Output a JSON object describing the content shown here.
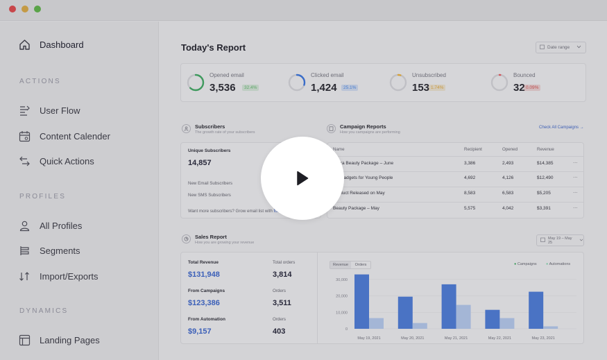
{
  "window": {
    "controls": [
      "close",
      "minimize",
      "maximize"
    ]
  },
  "sidebar": {
    "items": [
      {
        "label": "Dashboard",
        "icon": "home-icon"
      },
      {
        "label": "User Flow",
        "icon": "user-flow-icon"
      },
      {
        "label": "Content Calender",
        "icon": "calendar-icon"
      },
      {
        "label": "Quick Actions",
        "icon": "quick-actions-icon"
      },
      {
        "label": "All Profiles",
        "icon": "user-icon"
      },
      {
        "label": "Segments",
        "icon": "segments-icon"
      },
      {
        "label": "Import/Exports",
        "icon": "import-export-icon"
      },
      {
        "label": "Landing Pages",
        "icon": "layout-icon"
      }
    ],
    "sections": [
      "ACTIONS",
      "PROFILES",
      "DYNAMICS"
    ]
  },
  "main": {
    "title": "Today's Report",
    "date_range": "Date range",
    "stats": [
      {
        "label": "Opened email",
        "value": "3,536",
        "badge": "32.4%",
        "badge_color": "#5fa86a",
        "ring_color": "#3f9a5e",
        "fill": 0.62
      },
      {
        "label": "Clicked email",
        "value": "1,424",
        "badge": "25.1%",
        "badge_color": "#4a7fd0",
        "ring_color": "#3a6dc9",
        "fill": 0.3
      },
      {
        "label": "Unsubscribed",
        "value": "153",
        "badge": "1.74%",
        "badge_color": "#c99a40",
        "ring_color": "#d6a23c",
        "fill": 0.05
      },
      {
        "label": "Bounced",
        "value": "32",
        "badge": "0.09%",
        "badge_color": "#c05050",
        "ring_color": "#d2555a",
        "fill": 0.02
      }
    ],
    "subscribers": {
      "title": "Subscribers",
      "subtitle": "The growth rate of your subscribers",
      "unique_label": "Unique Subscribers",
      "unique_value": "14,857",
      "email_label": "New Email Subscribers",
      "sms_label": "New SMS Subscribers",
      "cta": "Want more subscribers? Grow email list with",
      "cta_link": "forms"
    },
    "campaigns": {
      "title": "Campaign Reports",
      "subtitle": "How you campaigns are performing",
      "link": "Check All Campaigns",
      "columns": [
        "Name",
        "Recipient",
        "Opened",
        "Revenue"
      ],
      "rows": [
        {
          "name": "phora Beauty Package – June",
          "recipient": "3,386",
          "opened": "2,493",
          "revenue": "$14,385"
        },
        {
          "name": "ing Gadgets for Young People",
          "recipient": "4,692",
          "opened": "4,126",
          "revenue": "$12,490"
        },
        {
          "name": "Product Released on May",
          "recipient": "8,583",
          "opened": "6,583",
          "revenue": "$5,205"
        },
        {
          "name": "Beauty Package – May",
          "recipient": "5,575",
          "opened": "4,042",
          "revenue": "$3,391"
        }
      ],
      "more": "···"
    },
    "sales": {
      "title": "Sales Report",
      "subtitle": "How you are growing your revenue",
      "date": "May 19 – May 25",
      "total_revenue_label": "Total Revenue",
      "total_revenue": "$131,948",
      "total_orders_label": "Total orders",
      "total_orders": "3,814",
      "campaigns_label": "From Campaigns",
      "campaigns_value": "$123,386",
      "campaigns_orders_label": "Orders",
      "campaigns_orders": "3,511",
      "automation_label": "From Automation",
      "automation_value": "$9,157",
      "automation_orders_label": "Orders",
      "automation_orders": "403",
      "tabs": [
        "Revenue",
        "Orders"
      ]
    }
  },
  "chart_data": {
    "type": "bar",
    "categories": [
      "May 19, 2021",
      "May 20, 2021",
      "May 21, 2021",
      "May 22, 2021",
      "May 23, 2021"
    ],
    "series": [
      {
        "name": "Campaigns",
        "values": [
          33000,
          19500,
          27000,
          11500,
          22500
        ],
        "color": "#4a73c4"
      },
      {
        "name": "Automations",
        "values": [
          6500,
          3500,
          14500,
          6500,
          1500
        ],
        "color": "#a4b6d6"
      }
    ],
    "yticks": [
      "30,000",
      "20,000",
      "10,000",
      "0"
    ],
    "ylim": [
      0,
      32000
    ],
    "legend": "top-right"
  },
  "overlay": {
    "control": "play"
  }
}
